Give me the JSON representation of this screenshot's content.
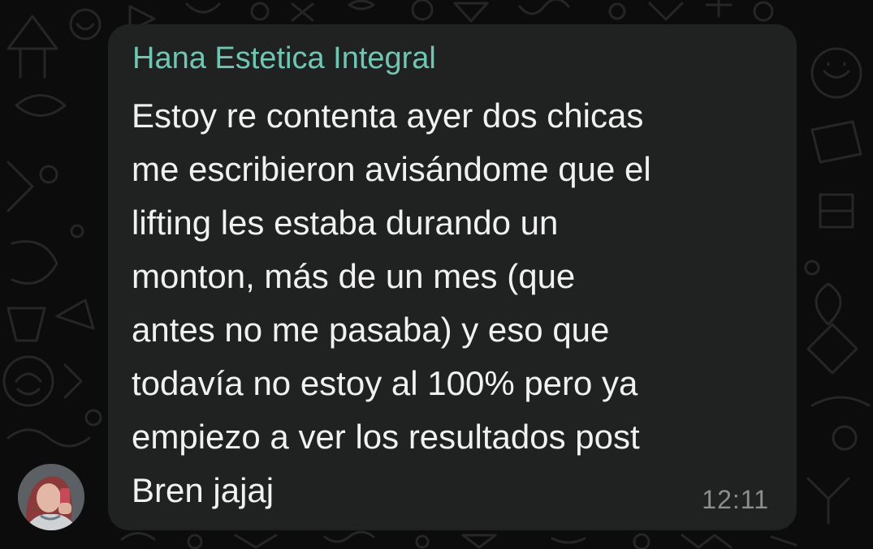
{
  "message": {
    "sender_name": "Hana Estetica Integral",
    "text": "Estoy re contenta ayer dos chicas\nme escribieron avisándome que el\nlifting les estaba durando un\nmonton, más de un mes (que\nantes no me pasaba) y eso que\ntodavía no estoy al 100% pero ya\nempiezo a ver los resultados post\nBren jajaj",
    "time": "12:11"
  },
  "colors": {
    "background": "#0c0c0c",
    "bubble": "#202121",
    "sender_name": "#71c5b3",
    "text": "#f1f1f1",
    "time": "#8c8d8d"
  },
  "icons": {
    "avatar": "sender-profile-photo",
    "wallpaper": "chat-doodle-pattern"
  }
}
